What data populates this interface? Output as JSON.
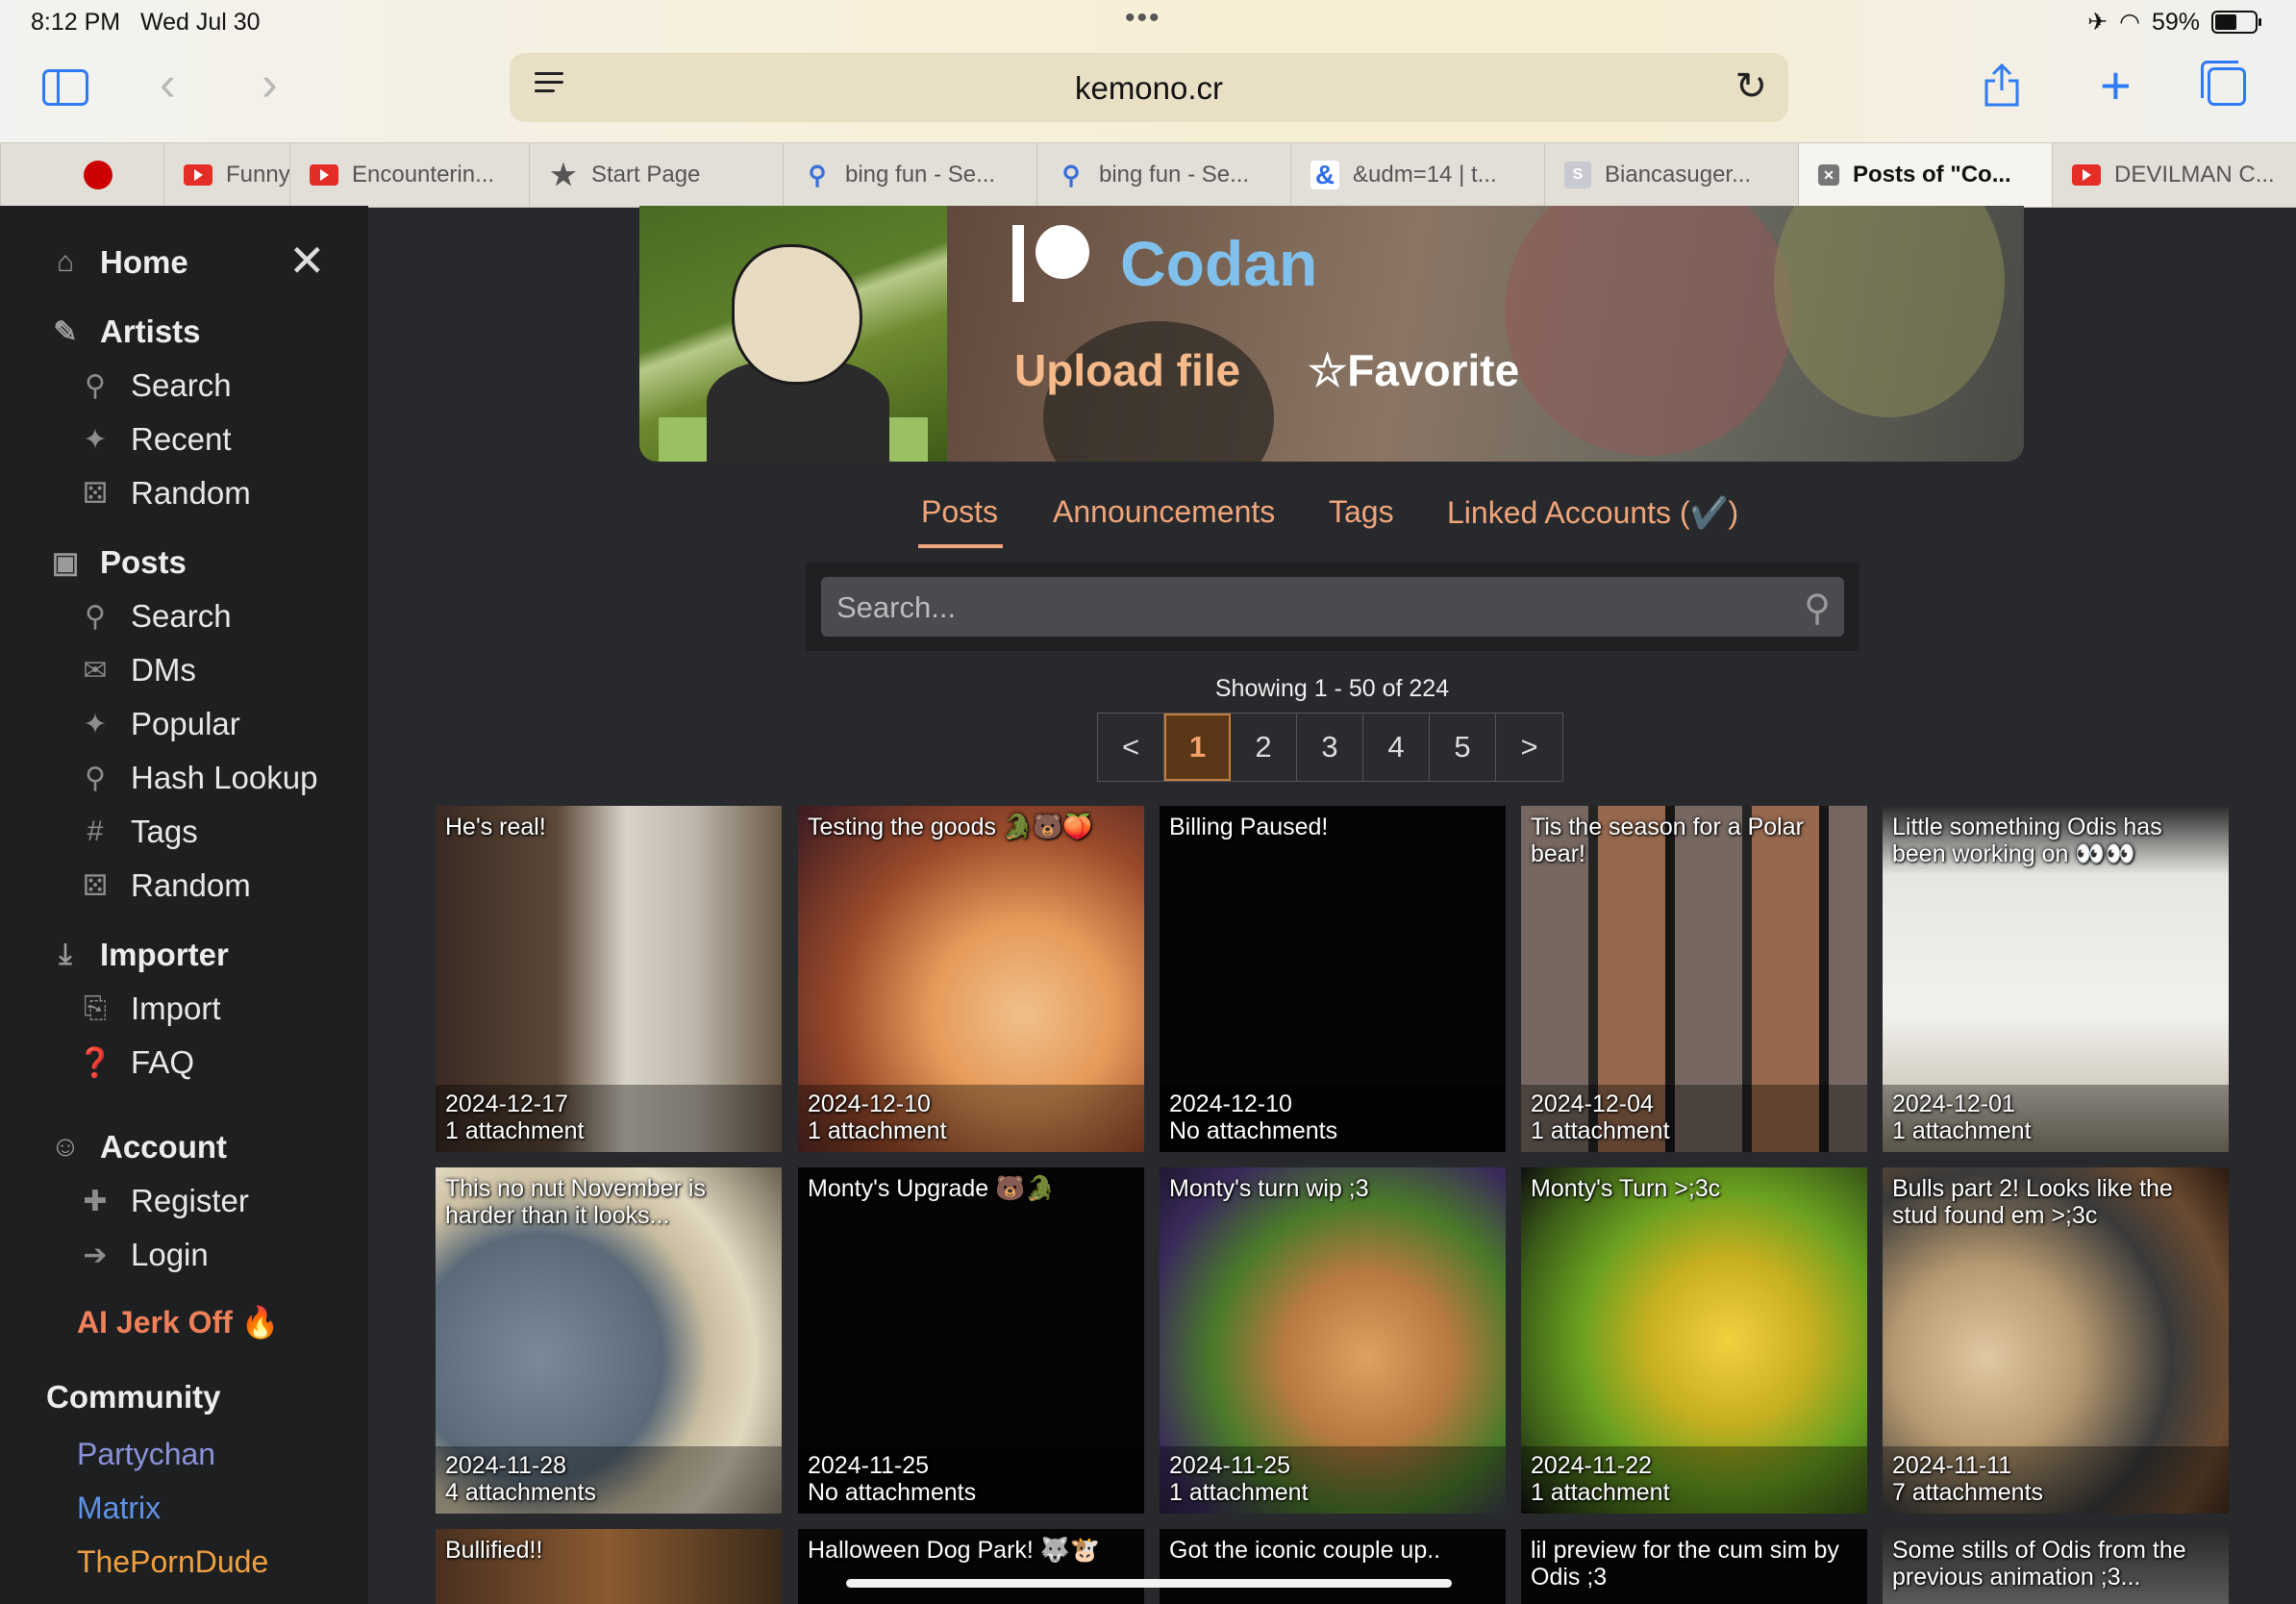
{
  "status": {
    "time": "8:12 PM",
    "date": "Wed Jul 30",
    "battery": "59%"
  },
  "browser": {
    "url": "kemono.cr"
  },
  "tabs": [
    {
      "label": "",
      "icon": "panda-icon"
    },
    {
      "label": "Funny I",
      "icon": "youtube-icon"
    },
    {
      "label": "Encounterin...",
      "icon": "youtube-icon"
    },
    {
      "label": "Start Page",
      "icon": "star-icon"
    },
    {
      "label": "bing fun - Se...",
      "icon": "search-icon"
    },
    {
      "label": "bing fun - Se...",
      "icon": "search-icon"
    },
    {
      "label": "&udm=14 | t...",
      "icon": "ampersand-icon"
    },
    {
      "label": "Biancasuger...",
      "icon": "s-icon"
    },
    {
      "label": "Posts of \"Co...",
      "icon": "close-icon",
      "active": true
    },
    {
      "label": "DEVILMAN C...",
      "icon": "youtube-icon"
    }
  ],
  "sidebar": {
    "home": "Home",
    "artists": {
      "title": "Artists",
      "items": [
        "Search",
        "Recent",
        "Random"
      ]
    },
    "posts": {
      "title": "Posts",
      "items": [
        "Search",
        "DMs",
        "Popular",
        "Hash Lookup",
        "Tags",
        "Random"
      ]
    },
    "importer": {
      "title": "Importer",
      "items": [
        "Import",
        "FAQ"
      ]
    },
    "account": {
      "title": "Account",
      "items": [
        "Register",
        "Login"
      ]
    },
    "ai_link": "AI Jerk Off 🔥",
    "community": {
      "title": "Community",
      "links": [
        "Partychan",
        "Matrix",
        "ThePornDude"
      ]
    }
  },
  "colors": {
    "accent": "#f0a57a",
    "artist_name": "#7fc0ec",
    "partychan": "#8a92d8",
    "matrix": "#5f93e8",
    "theporndude": "#f0a040",
    "ai_link": "#f0805a"
  },
  "artist": {
    "name": "Codan",
    "upload": "Upload file",
    "favorite": "☆Favorite"
  },
  "nav": {
    "posts": "Posts",
    "announcements": "Announcements",
    "tags": "Tags",
    "linked": "Linked Accounts (✔️)"
  },
  "search": {
    "placeholder": "Search..."
  },
  "showing": "Showing 1 - 50 of 224",
  "pager": [
    "<",
    "1",
    "2",
    "3",
    "4",
    "5",
    ">"
  ],
  "posts": [
    {
      "title": "He's real!",
      "date": "2024-12-17",
      "attachments": "1 attachment"
    },
    {
      "title": "Testing the goods 🐊🐻🍑",
      "date": "2024-12-10",
      "attachments": "1 attachment"
    },
    {
      "title": "Billing Paused!",
      "date": "2024-12-10",
      "attachments": "No attachments"
    },
    {
      "title": "Tis the season for a Polar bear!",
      "date": "2024-12-04",
      "attachments": "1 attachment"
    },
    {
      "title": "Little something Odis has been working on 👀👀",
      "date": "2024-12-01",
      "attachments": "1 attachment"
    },
    {
      "title": "This no nut November is harder than it looks...",
      "date": "2024-11-28",
      "attachments": "4 attachments"
    },
    {
      "title": "Monty's Upgrade 🐻🐊",
      "date": "2024-11-25",
      "attachments": "No attachments"
    },
    {
      "title": "Monty's turn wip ;3",
      "date": "2024-11-25",
      "attachments": "1 attachment"
    },
    {
      "title": "Monty's Turn >;3c",
      "date": "2024-11-22",
      "attachments": "1 attachment"
    },
    {
      "title": "Bulls part 2! Looks like the stud found em >;3c",
      "date": "2024-11-11",
      "attachments": "7 attachments"
    },
    {
      "title": "Bullified!!",
      "date": "",
      "attachments": ""
    },
    {
      "title": "Halloween Dog Park! 🐺🐮",
      "date": "",
      "attachments": ""
    },
    {
      "title": "Got the iconic couple up..",
      "date": "",
      "attachments": ""
    },
    {
      "title": "lil preview for the cum sim by Odis ;3",
      "date": "",
      "attachments": ""
    },
    {
      "title": "Some stills of Odis from the previous animation ;3...",
      "date": "",
      "attachments": ""
    }
  ]
}
